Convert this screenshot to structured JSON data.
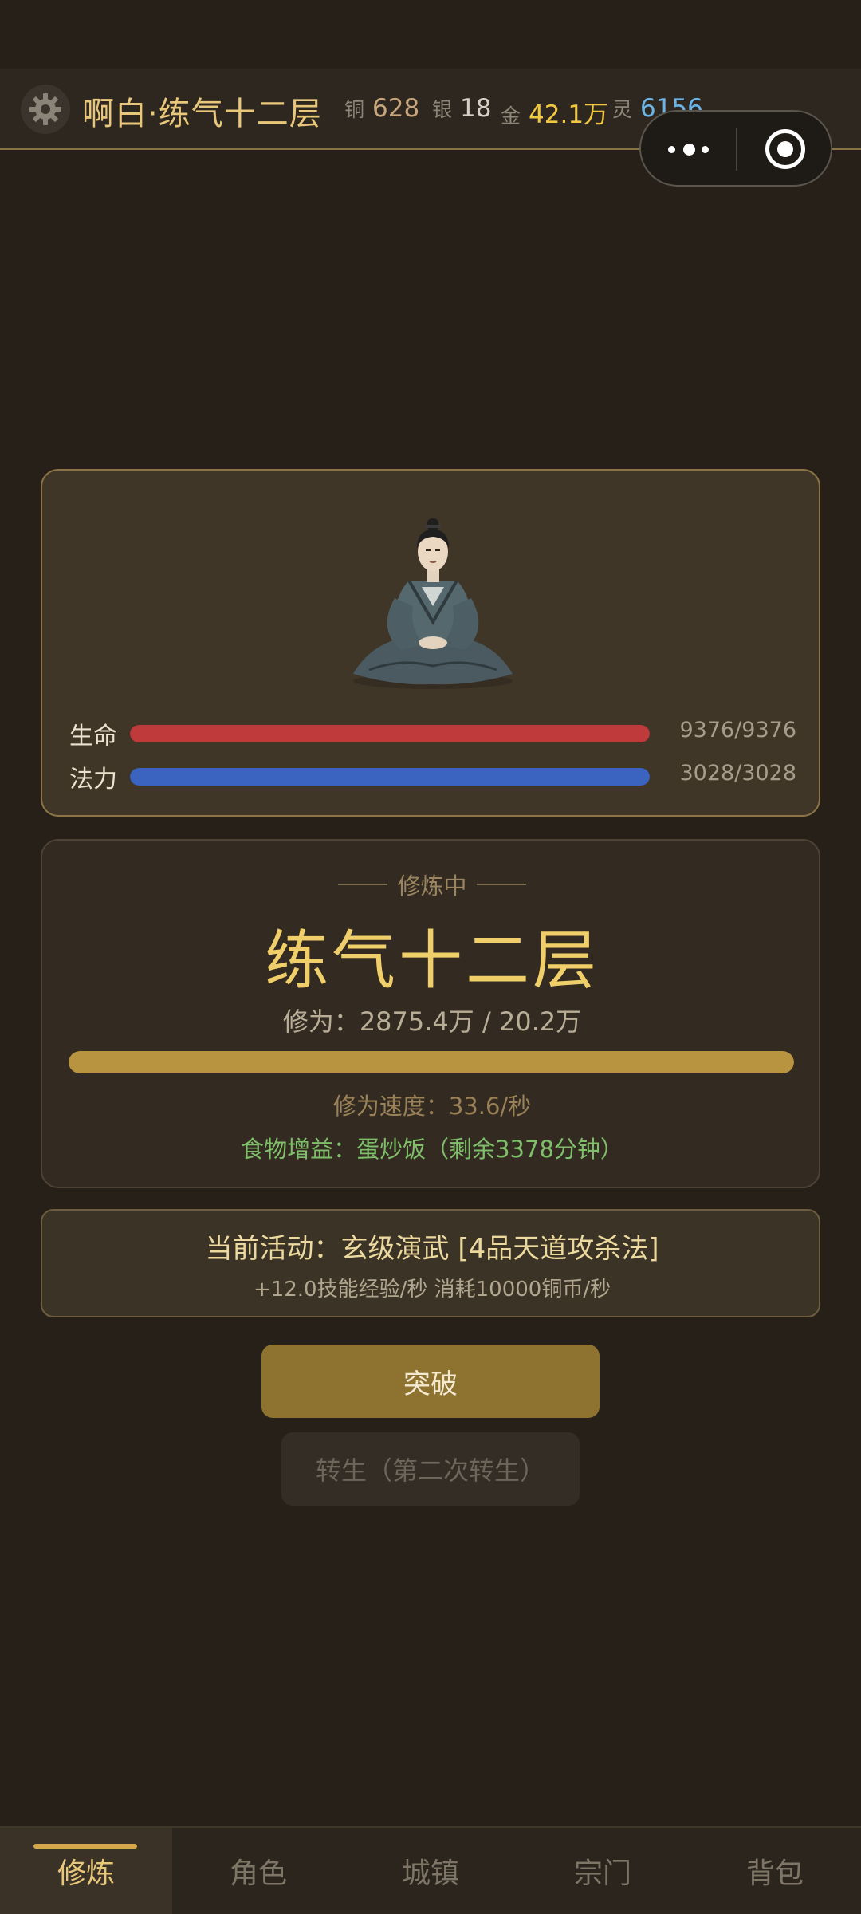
{
  "header": {
    "title": "啊白·练气十二层",
    "currencies": {
      "copper": {
        "label": "铜",
        "value": "628"
      },
      "silver": {
        "label": "银",
        "value": "18"
      },
      "gold": {
        "label": "金",
        "value": "42.1万"
      },
      "spirit": {
        "label": "灵",
        "value": "6156"
      }
    }
  },
  "character": {
    "hp": {
      "label": "生命",
      "value": "9376/9376",
      "fraction": 1.0
    },
    "mp": {
      "label": "法力",
      "value": "3028/3028",
      "fraction": 1.0
    }
  },
  "cultivation": {
    "status": "修炼中",
    "realm": "练气十二层",
    "progress_text": "修为：2875.4万 / 20.2万",
    "progress_fraction": 1.0,
    "speed_text": "修为速度：33.6/秒",
    "food_text": "食物增益：蛋炒饭（剩余3378分钟）"
  },
  "activity": {
    "title": "当前活动：玄级演武 [4品天道攻杀法]",
    "detail": "+12.0技能经验/秒  消耗10000铜币/秒"
  },
  "buttons": {
    "breakthrough": "突破",
    "rebirth": "转生（第二次转生）"
  },
  "nav": [
    {
      "label": "修炼",
      "active": true
    },
    {
      "label": "角色",
      "active": false
    },
    {
      "label": "城镇",
      "active": false
    },
    {
      "label": "宗门",
      "active": false
    },
    {
      "label": "背包",
      "active": false
    }
  ],
  "colors": {
    "background": "#262019",
    "accent_gold": "#e8c77a",
    "hp_bar": "#bf3a3a",
    "mp_bar": "#3a64bf",
    "cultivation_bar": "#b89440",
    "food_text": "#7fbf6a",
    "spirit_value": "#6cb3e6"
  },
  "icons": [
    "gear-icon",
    "more-dots-icon",
    "close-target-icon",
    "meditating-cultivator-icon"
  ]
}
